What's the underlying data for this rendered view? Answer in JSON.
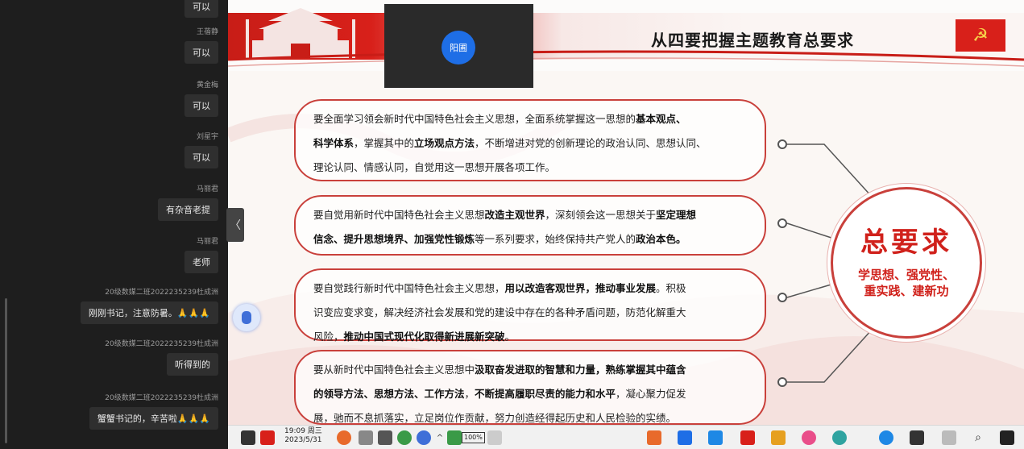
{
  "chat": {
    "messages": [
      {
        "sender": "",
        "text": "可以"
      },
      {
        "sender": "王蓓静",
        "text": "可以"
      },
      {
        "sender": "黄金梅",
        "text": "可以"
      },
      {
        "sender": "刘星宇",
        "text": "可以"
      },
      {
        "sender": "马丽君",
        "text": "有杂音老提"
      },
      {
        "sender": "马丽君",
        "text": "老师"
      },
      {
        "sender": "20级数媒二班2022235239杜成洲",
        "text": "刚刚书记，注意防暑。🙏🙏🙏"
      },
      {
        "sender": "20级数媒二班2022235239杜成洲",
        "text": "听得到的"
      },
      {
        "sender": "20级数媒二班2022235239杜成洲",
        "text": "蟹蟹书记的，辛苦啦🙏🙏🙏"
      }
    ]
  },
  "video": {
    "presenter_label": "阳圃"
  },
  "slide": {
    "title": "从四要把握主题教育总要求",
    "flag_symbol": "☭",
    "panels": [
      {
        "lines": [
          [
            {
              "t": "要全面学习领会新时代中国特色社会主义思想，全面系统掌握这一思想的"
            },
            {
              "t": "基本观点、",
              "b": true
            }
          ],
          [
            {
              "t": "科学体系",
              "b": true
            },
            {
              "t": "，掌握其中的"
            },
            {
              "t": "立场观点方法",
              "b": true
            },
            {
              "t": "，不断增进对党的创新理论的政治认同、思想认同、"
            }
          ],
          [
            {
              "t": "理论认同、情感认同，自觉用这一思想开展各项工作。"
            }
          ]
        ]
      },
      {
        "lines": [
          [
            {
              "t": "要自觉用新时代中国特色社会主义思想"
            },
            {
              "t": "改造主观世界",
              "b": true
            },
            {
              "t": "，深刻领会这一思想关于"
            },
            {
              "t": "坚定理想",
              "b": true
            }
          ],
          [
            {
              "t": "信念、提升思想境界、加强党性锻炼",
              "b": true
            },
            {
              "t": "等一系列要求，始终保持共产党人的"
            },
            {
              "t": "政治本色。",
              "b": true
            }
          ]
        ]
      },
      {
        "lines": [
          [
            {
              "t": "要自觉践行新时代中国特色社会主义思想，"
            },
            {
              "t": "用以改造客观世界，推动事业发展",
              "b": true
            },
            {
              "t": "。积极"
            }
          ],
          [
            {
              "t": "识变应变求变，解决经济社会发展和党的建设中存在的各种矛盾问题，防范化解重大"
            }
          ],
          [
            {
              "t": "风险，"
            },
            {
              "t": "推动中国式现代化取得新进展新突破",
              "b": true
            },
            {
              "t": "。"
            }
          ]
        ]
      },
      {
        "lines": [
          [
            {
              "t": "要从新时代中国特色社会主义思想中"
            },
            {
              "t": "汲取奋发进取的智慧和力量，熟练掌握其中蕴含",
              "b": true
            }
          ],
          [
            {
              "t": "的领导方法、思想方法、工作方法",
              "b": true
            },
            {
              "t": "，"
            },
            {
              "t": "不断提高履职尽责的能力和水平",
              "b": true
            },
            {
              "t": "，凝心聚力促发"
            }
          ],
          [
            {
              "t": "展，驰而不息抓落实，立足岗位作贡献，努力创造经得起历史和人民检验的实绩。"
            }
          ]
        ]
      }
    ],
    "center": {
      "big": "总要求",
      "sub": "学思想、强党性、重实践、建新功"
    }
  },
  "taskbar": {
    "clock_time": "19:09 周三",
    "clock_date": "2023/5/31",
    "battery": "100%",
    "accent": "#1e6ee6"
  }
}
